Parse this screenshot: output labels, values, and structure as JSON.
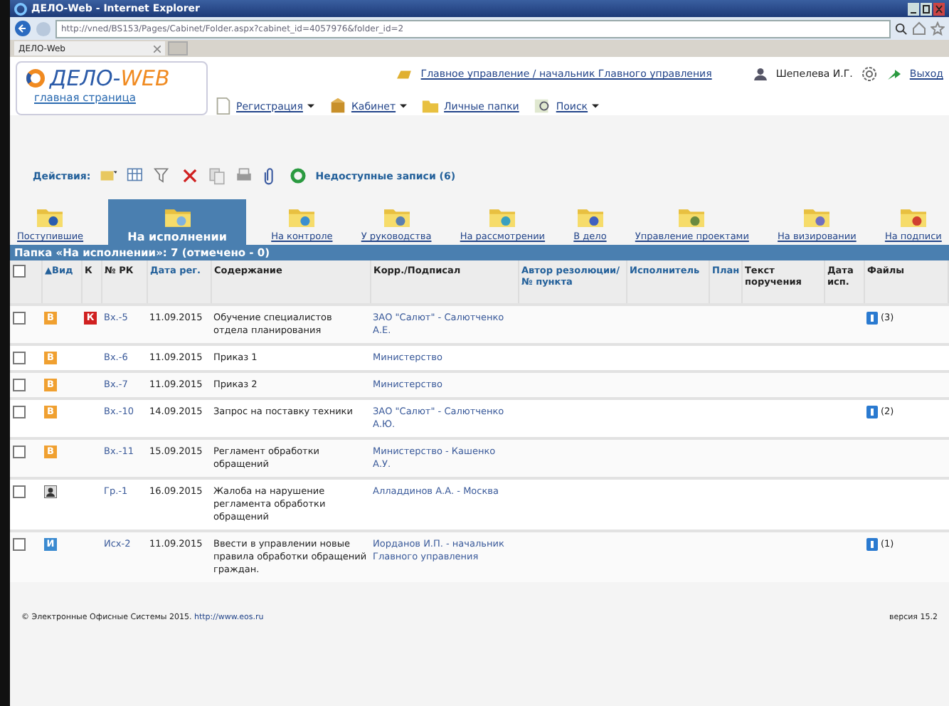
{
  "window": {
    "title": "ДЕЛО-Web - Internet Explorer"
  },
  "address_bar": {
    "value": "http://vned/BS153/Pages/Cabinet/Folder.aspx?cabinet_id=4057976&folder_id=2"
  },
  "browser_tab": {
    "label": "ДЕЛО-Web"
  },
  "logo": {
    "name_1": "ДЕЛО-",
    "name_2": "WEB",
    "subtitle": "главная страница"
  },
  "header": {
    "department_link": "Главное управление / начальник Главного управления",
    "user": "Шепелева И.Г.",
    "exit": "Выход"
  },
  "menu": [
    "Регистрация",
    "Кабинет",
    "Личные папки",
    "Поиск"
  ],
  "actions": {
    "label": "Действия:",
    "unavailable_link": "Недоступные записи (6)"
  },
  "folder_tabs": [
    {
      "label": "Поступившие",
      "selected": false
    },
    {
      "label": "На исполнении",
      "selected": true
    },
    {
      "label": "На контроле",
      "selected": false
    },
    {
      "label": "У руководства",
      "selected": false
    },
    {
      "label": "На рассмотрении",
      "selected": false
    },
    {
      "label": "В дело",
      "selected": false
    },
    {
      "label": "Управление проектами",
      "selected": false
    },
    {
      "label": "На визировании",
      "selected": false
    },
    {
      "label": "На подписи",
      "selected": false
    }
  ],
  "folder_header": "Папка «На исполнении»: 7 (отмечено - 0)",
  "table": {
    "select_all_checked": false,
    "columns": [
      {
        "label": "▲Вид",
        "sortable": true
      },
      {
        "label": "К",
        "sortable": false
      },
      {
        "label": "№ РК",
        "sortable": false
      },
      {
        "label": "Дата рег.",
        "sortable": true
      },
      {
        "label": "Содержание",
        "sortable": false
      },
      {
        "label": "Корр./Подписал",
        "sortable": false
      },
      {
        "label": "Автор резолюции/№ пункта",
        "sortable": true
      },
      {
        "label": "Исполнитель",
        "sortable": true
      },
      {
        "label": "План",
        "sortable": true
      },
      {
        "label": "Текст поручения",
        "sortable": false
      },
      {
        "label": "Дата исп.",
        "sortable": false
      },
      {
        "label": "Файлы",
        "sortable": false
      }
    ],
    "rows": [
      {
        "checked": false,
        "kind": "letter",
        "type_letter": "В",
        "control": "К",
        "number": "Вх.-5",
        "date": "11.09.2015",
        "content": "Обучение специалистов отдела планирования",
        "correspondent": "ЗАО \"Салют\" - Салютченко А.Е.",
        "files": "(3)"
      },
      {
        "checked": false,
        "kind": "letter",
        "type_letter": "В",
        "number": "Вх.-6",
        "date": "11.09.2015",
        "content": "Приказ 1",
        "correspondent": "Министерство"
      },
      {
        "checked": false,
        "kind": "letter",
        "type_letter": "В",
        "number": "Вх.-7",
        "date": "11.09.2015",
        "content": "Приказ 2",
        "correspondent": "Министерство"
      },
      {
        "checked": false,
        "kind": "letter",
        "type_letter": "В",
        "number": "Вх.-10",
        "date": "14.09.2015",
        "content": "Запрос на поставку техники",
        "correspondent": "ЗАО \"Салют\" - Салютченко А.Ю.",
        "files": "(2)"
      },
      {
        "checked": false,
        "kind": "letter",
        "type_letter": "В",
        "number": "Вх.-11",
        "date": "15.09.2015",
        "content": "Регламент обработки обращений",
        "correspondent": "Министерство - Кашенко А.У."
      },
      {
        "checked": false,
        "kind": "person",
        "number": "Гр.-1",
        "date": "16.09.2015",
        "content": "Жалоба на нарушение регламента обработки обращений",
        "correspondent": "Алладдинов А.А. - Москва"
      },
      {
        "checked": false,
        "kind": "outgoing",
        "type_letter": "И",
        "number": "Исх-2",
        "date": "11.09.2015",
        "content": "Ввести в управлении новые правила обработки обращений граждан.",
        "correspondent": "Иорданов И.П. - начальник Главного управления",
        "files": "(1)"
      }
    ]
  },
  "footer": {
    "copyright": "© Электронные Офисные Системы 2015.",
    "link": "http://www.eos.ru",
    "version": "версия 15.2"
  }
}
